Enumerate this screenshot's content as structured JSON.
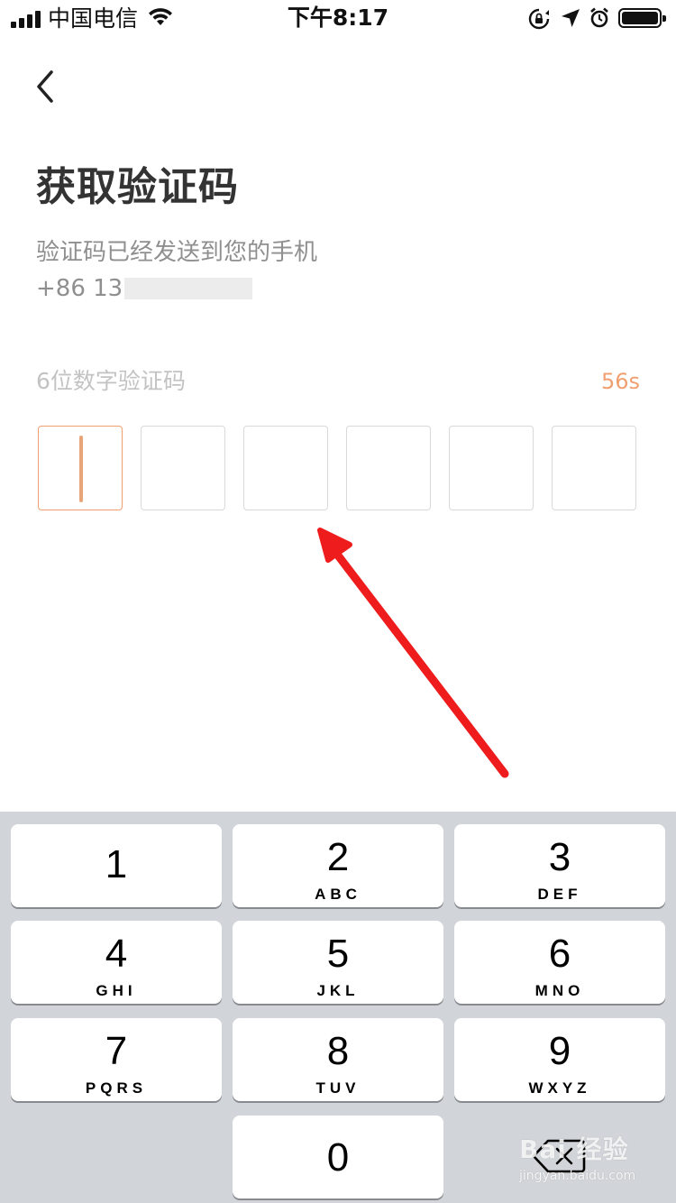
{
  "status_bar": {
    "carrier": "中国电信",
    "time": "下午8:17"
  },
  "page": {
    "title": "获取验证码",
    "subtitle": "验证码已经发送到您的手机",
    "phone_prefix": "+86 13",
    "code_label": "6位数字验证码",
    "countdown": "56s",
    "code_length": 6,
    "accent_color": "#F0A070"
  },
  "keypad": {
    "keys": [
      {
        "digit": "1",
        "letters": ""
      },
      {
        "digit": "2",
        "letters": "ABC"
      },
      {
        "digit": "3",
        "letters": "DEF"
      },
      {
        "digit": "4",
        "letters": "GHI"
      },
      {
        "digit": "5",
        "letters": "JKL"
      },
      {
        "digit": "6",
        "letters": "MNO"
      },
      {
        "digit": "7",
        "letters": "PQRS"
      },
      {
        "digit": "8",
        "letters": "TUV"
      },
      {
        "digit": "9",
        "letters": "WXYZ"
      },
      {
        "digit": "0",
        "letters": ""
      }
    ],
    "delete_icon": "backspace-icon"
  },
  "watermark": {
    "brand": "Bai 经验",
    "url": "jingyan.baidu.com"
  }
}
